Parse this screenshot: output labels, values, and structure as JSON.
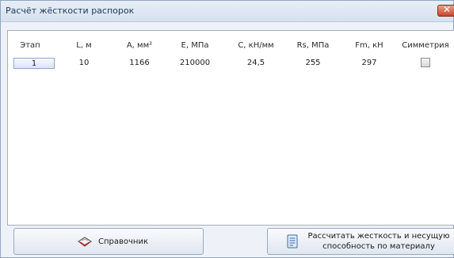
{
  "window": {
    "title": "Расчёт жёсткости распорок",
    "close_glyph": "✕"
  },
  "table": {
    "columns": [
      "Этап",
      "L, м",
      "A, мм²",
      "E, МПа",
      "C, кН/мм",
      "Rs, МПа",
      "Fm, кН",
      "Симметрия"
    ],
    "rows": [
      {
        "stage": "1",
        "L": "10",
        "A": "1166",
        "E": "210000",
        "C": "24,5",
        "Rs": "255",
        "Fm": "297",
        "symmetry": false
      }
    ]
  },
  "buttons": {
    "reference_label": "Справочник",
    "calc_label_line1": "Рассчитать жесткость и несущую",
    "calc_label_line2": "способность по материалу"
  },
  "icons": {
    "reference": "book-icon",
    "calc": "document-icon",
    "close": "close-icon"
  },
  "colors": {
    "title_text": "#1e395b",
    "close_red": "#c9452b",
    "window_bg": "#eef2f8"
  }
}
